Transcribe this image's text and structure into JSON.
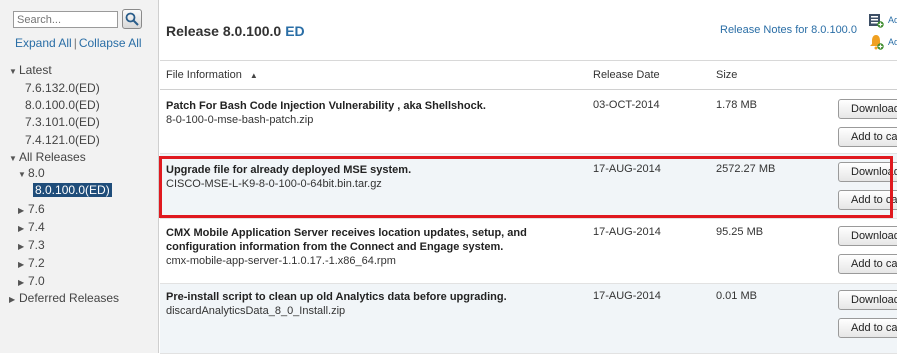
{
  "sidebar": {
    "search_placeholder": "Search...",
    "expand_all": "Expand All",
    "separator": "|",
    "collapse_all": "Collapse All",
    "tree": [
      {
        "label": "Latest",
        "toggle": "▼"
      },
      {
        "label": "7.6.132.0(ED)"
      },
      {
        "label": "8.0.100.0(ED)"
      },
      {
        "label": "7.3.101.0(ED)"
      },
      {
        "label": "7.4.121.0(ED)"
      },
      {
        "label": "All Releases",
        "toggle": "▼"
      },
      {
        "label": "8.0",
        "toggle": "▼"
      },
      {
        "label": "8.0.100.0(ED)",
        "selected": true
      },
      {
        "label": "7.6",
        "toggle": "▶"
      },
      {
        "label": "7.4",
        "toggle": "▶"
      },
      {
        "label": "7.3",
        "toggle": "▶"
      },
      {
        "label": "7.2",
        "toggle": "▶"
      },
      {
        "label": "7.0",
        "toggle": "▶"
      },
      {
        "label": "Deferred Releases",
        "toggle": "▶"
      }
    ]
  },
  "header": {
    "title": "Release 8.0.100.0",
    "badge": "ED",
    "notes_link": "Release Notes for 8.0.100.0",
    "side_text_1": "Ad",
    "side_text_2": "Ad"
  },
  "table": {
    "columns": {
      "file": "File Information",
      "date": "Release Date",
      "size": "Size"
    },
    "download_label": "Download",
    "cart_label": "Add to cart",
    "rows": [
      {
        "title": "Patch For Bash Code Injection Vulnerability , aka Shellshock.",
        "file": "8-0-100-0-mse-bash-patch.zip",
        "date": "03-OCT-2014",
        "size": "1.78 MB"
      },
      {
        "title": "Upgrade file for already deployed MSE system.",
        "file": "CISCO-MSE-L-K9-8-0-100-0-64bit.bin.tar.gz",
        "date": "17-AUG-2014",
        "size": "2572.27 MB"
      },
      {
        "title": "CMX Mobile Application Server receives location updates, setup, and configuration information from the Connect and Engage system.",
        "file": "cmx-mobile-app-server-1.1.0.17.-1.x86_64.rpm",
        "date": "17-AUG-2014",
        "size": "95.25 MB"
      },
      {
        "title": "Pre-install script to clean up old Analytics data before upgrading.",
        "file": "discardAnalyticsData_8_0_Install.zip",
        "date": "17-AUG-2014",
        "size": "0.01 MB"
      }
    ]
  },
  "colors": {
    "accent": "#2a6ea6",
    "highlight": "#e0191f",
    "selected_bg": "#1f4d7a"
  }
}
